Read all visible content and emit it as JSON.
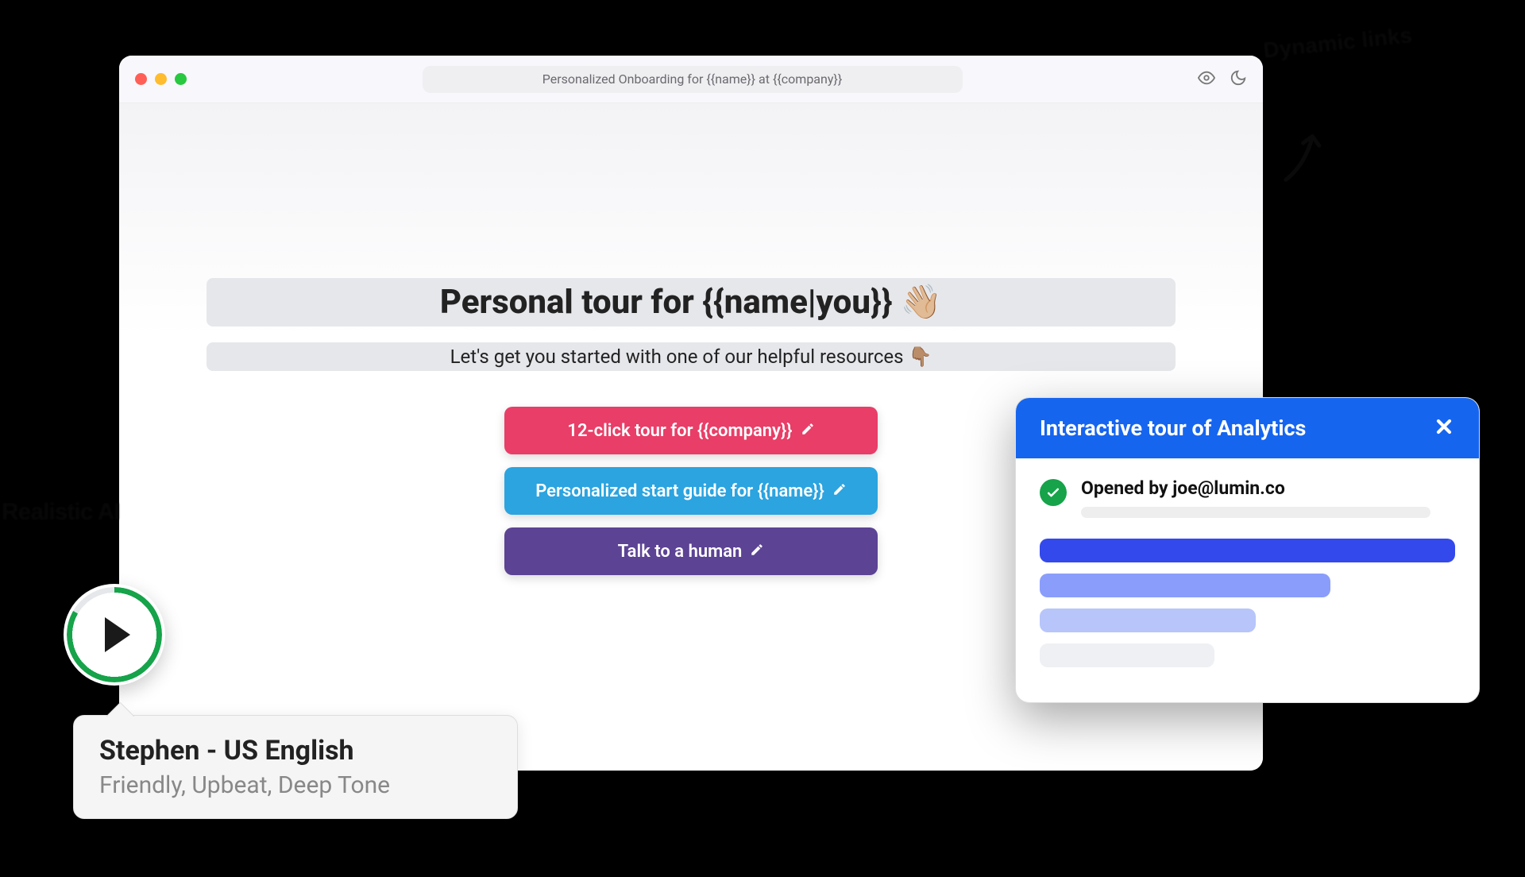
{
  "browser": {
    "url": "Personalized Onboarding for {{name}} at {{company}}"
  },
  "page": {
    "heading": "Personal tour for {{name|you}} 👋🏼",
    "subheading": "Let's get you started with one of our helpful resources 👇🏽",
    "buttons": {
      "tour": "12-click tour for {{company}}",
      "guide": "Personalized start guide for {{name}}",
      "human": "Talk to a human"
    }
  },
  "voice": {
    "name": "Stephen - US English",
    "description": "Friendly, Upbeat, Deep Tone"
  },
  "analytics": {
    "title": "Interactive tour of Analytics",
    "opened_by": "Opened by joe@lumin.co"
  },
  "annotations": {
    "leftLabel": "Realistic AI",
    "topRight": "Dynamic links"
  }
}
